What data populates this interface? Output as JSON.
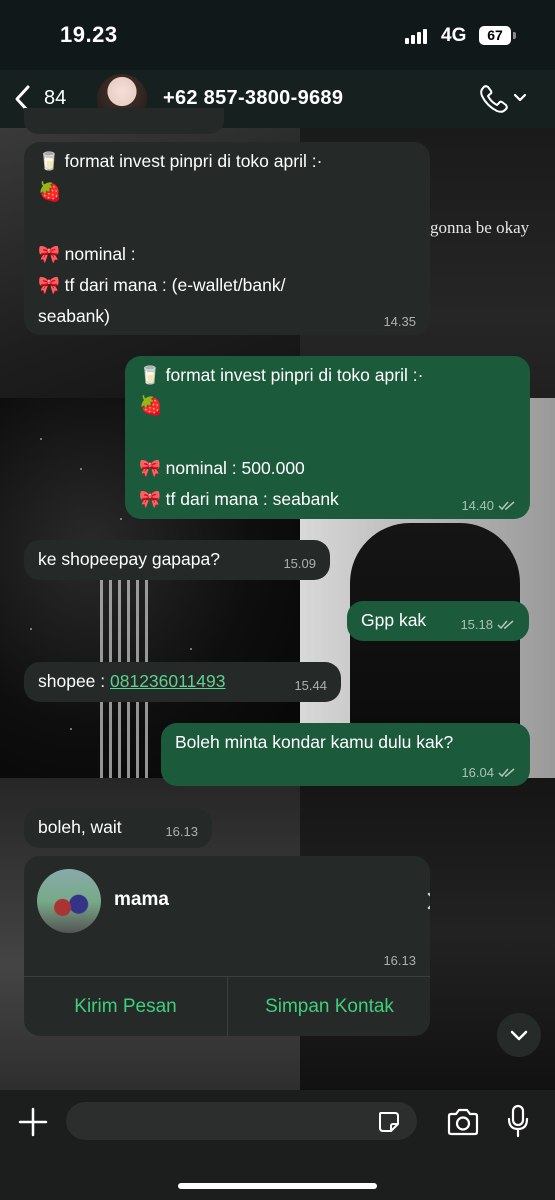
{
  "status_bar": {
    "time": "19.23",
    "network": "4G",
    "battery": "67"
  },
  "header": {
    "unread_count": "84",
    "contact_name": "+62 857-3800-9689",
    "icons": [
      "chevron-left-icon",
      "avatar",
      "phone-icon",
      "chevron-down-icon"
    ]
  },
  "wallpaper": {
    "text": "gonna be okay"
  },
  "messages": [
    {
      "dir": "in",
      "lines": [
        "🥛 format invest pinpri di toko april :·",
        "🍓",
        "",
        "🎀 nominal :",
        "🎀 tf dari mana : (e-wallet/bank/",
        "seabank)"
      ],
      "time": "14.35"
    },
    {
      "dir": "out",
      "lines": [
        "🥛 format invest pinpri di toko april :·",
        "🍓",
        "",
        "🎀 nominal : 500.000",
        "🎀 tf dari mana : seabank"
      ],
      "time": "14.40",
      "read": true
    },
    {
      "dir": "in",
      "text": "ke shopeepay gapapa?",
      "time": "15.09"
    },
    {
      "dir": "out",
      "text": "Gpp kak",
      "time": "15.18",
      "read": true
    },
    {
      "dir": "in",
      "text_prefix": "shopee : ",
      "link": "081236011493",
      "time": "15.44"
    },
    {
      "dir": "out",
      "text": "Boleh minta kondar kamu dulu kak?",
      "time": "16.04",
      "read": true
    },
    {
      "dir": "in",
      "text": "boleh, wait",
      "time": "16.13"
    }
  ],
  "contact_card": {
    "name": "mama",
    "time": "16.13",
    "send_label": "Kirim Pesan",
    "save_label": "Simpan Kontak"
  },
  "input_bar": {
    "placeholder": "",
    "icons": [
      "plus-icon",
      "sticker-icon",
      "camera-icon",
      "microphone-icon"
    ]
  },
  "colors": {
    "incoming_bubble": "#252927",
    "outgoing_bubble": "#1c5a3c",
    "accent_green": "#3fcf7b",
    "link_green": "#5cd28c"
  }
}
